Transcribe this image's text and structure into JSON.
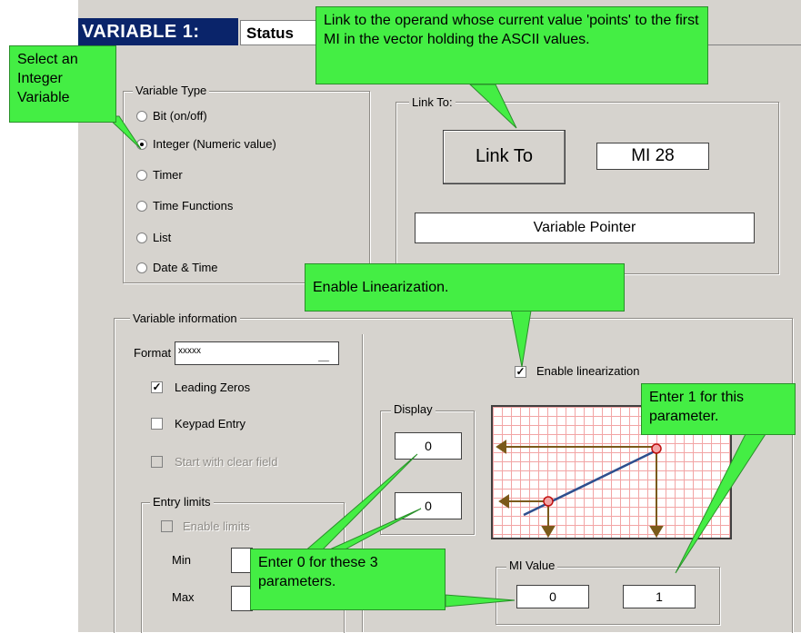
{
  "window": {
    "title": "VARIABLE 1:",
    "tab_label": "Status"
  },
  "variable_type": {
    "legend": "Variable Type",
    "options": [
      {
        "label": "Bit (on/off)",
        "selected": false
      },
      {
        "label": "Integer (Numeric value)",
        "selected": true
      },
      {
        "label": "Timer",
        "selected": false
      },
      {
        "label": "Time Functions",
        "selected": false
      },
      {
        "label": "List",
        "selected": false
      },
      {
        "label": "Date & Time",
        "selected": false
      }
    ]
  },
  "link_to": {
    "legend": "Link To:",
    "button_label": "Link To",
    "operand": "MI  28",
    "description": "Variable Pointer"
  },
  "variable_info": {
    "legend": "Variable information",
    "format_label": "Format",
    "format_value": "xxxxx",
    "leading_zeros": {
      "label": "Leading Zeros",
      "checked": true
    },
    "keypad_entry": {
      "label": "Keypad Entry",
      "checked": false
    },
    "start_clear": {
      "label": "Start with clear field",
      "checked": false
    },
    "entry_limits": {
      "legend": "Entry limits",
      "enable_label": "Enable limits",
      "min_label": "Min",
      "max_label": "Max"
    }
  },
  "linearization": {
    "enable_label": "Enable linearization",
    "enabled": true,
    "display_legend": "Display",
    "display_values": [
      "0",
      "0"
    ],
    "mi_legend": "MI Value",
    "mi_values": [
      "0",
      "1"
    ]
  },
  "callouts": {
    "select_integer": "Select an Integer Variable",
    "link_operand": "Link to the operand whose current value 'points' to the first MI in the  vector holding the ASCII  values.",
    "enable_lin": "Enable Linearization.",
    "enter_one": "Enter 1 for this parameter.",
    "enter_zero": "Enter  0 for these 3 parameters."
  },
  "colors": {
    "callout_bg": "#44ee44",
    "title_bg": "#0a246a",
    "dialog_bg": "#d6d3ce",
    "graph_line": "#2e4f8e",
    "graph_arrow": "#7a5a1a"
  }
}
